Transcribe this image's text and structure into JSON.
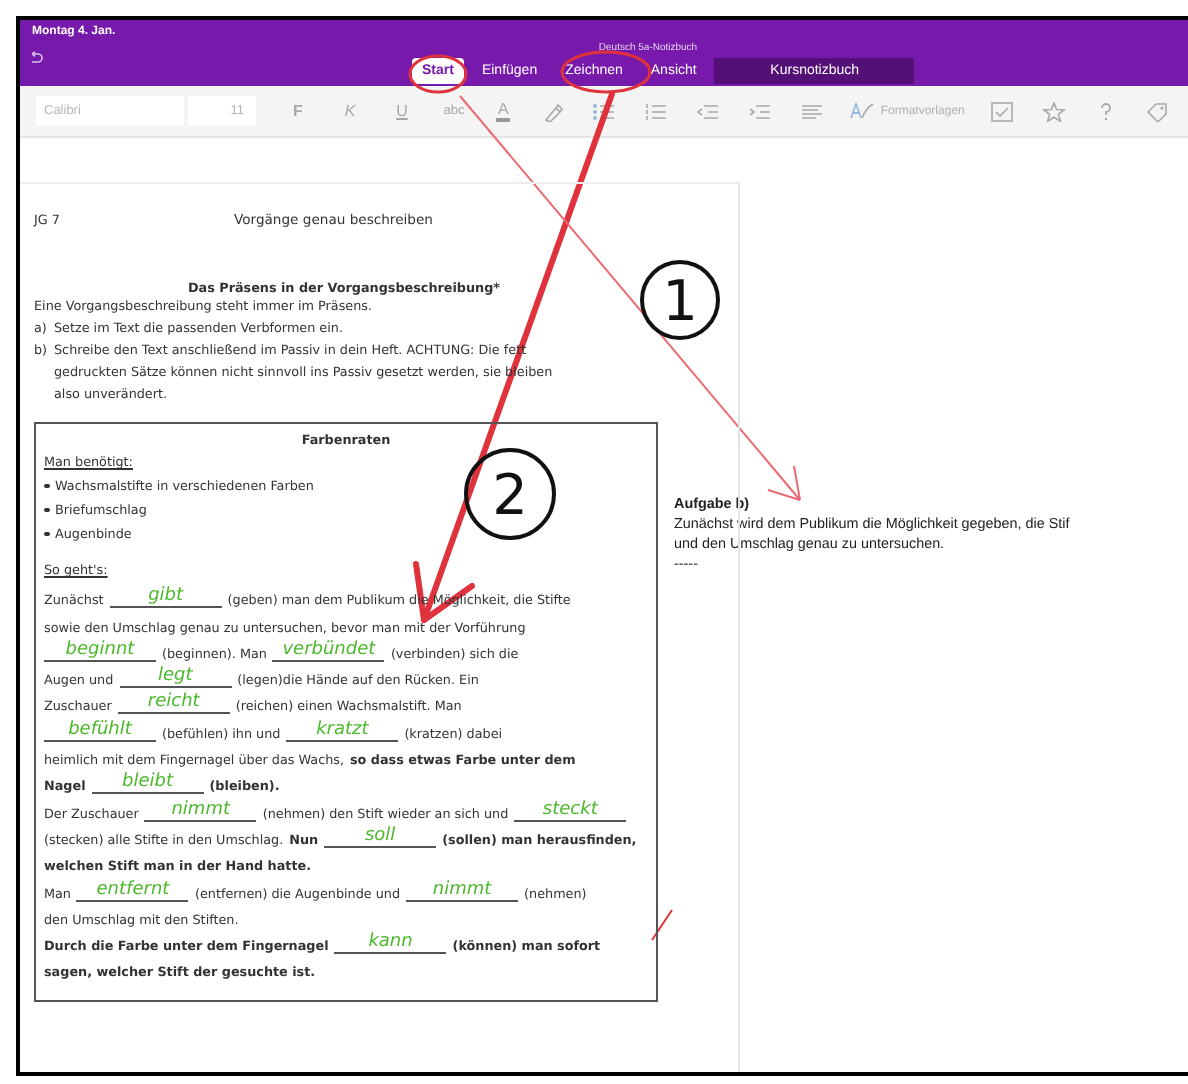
{
  "header": {
    "date": "Montag 4. Jan.",
    "notebook": "Deutsch 5a-Notizbuch"
  },
  "tabs": [
    {
      "label": "Start",
      "selected": true,
      "kind": "ribbon"
    },
    {
      "label": "Einfügen",
      "selected": false,
      "kind": "ribbon"
    },
    {
      "label": "Zeichnen",
      "selected": false,
      "kind": "ribbon"
    },
    {
      "label": "Ansicht",
      "selected": false,
      "kind": "ribbon"
    },
    {
      "label": "Kursnotizbuch",
      "selected": false,
      "kind": "class"
    }
  ],
  "toolbar": {
    "font_name": "Calibri",
    "font_size": "11",
    "format_buttons": [
      "F",
      "K",
      "U",
      "abc"
    ],
    "font_color_button": "A",
    "styles_button": "Formatvorlagen"
  },
  "worksheet": {
    "class": "JG 7",
    "topic": "Vorgänge genau beschreiben",
    "heading": "Das Präsens in der Vorgangsbeschreibung*",
    "intro": "Eine Vorgangsbeschreibung steht immer im Präsens.",
    "tasks": [
      {
        "marker": "a)",
        "lines": [
          "Setze im Text die passenden Verbformen ein."
        ]
      },
      {
        "marker": "b)",
        "lines": [
          "Schreibe den Text anschließend im Passiv in dein Heft. ACHTUNG: Die fett",
          "gedruckten Sätze können nicht sinnvoll ins Passiv gesetzt werden, sie bleiben",
          "also unverändert."
        ]
      }
    ],
    "box": {
      "title": "Farbenraten",
      "materials_label": "Man benötigt:",
      "materials": [
        "Wachsmalstifte in verschiedenen Farben",
        "Briefumschlag",
        "Augenbinde"
      ],
      "steps_label": "So geht's:",
      "lines": [
        [
          {
            "kind": "text",
            "text": "Zunächst",
            "bold": false
          },
          {
            "kind": "blank",
            "answer": "gibt"
          },
          {
            "kind": "text",
            "text": "(geben) man dem Publikum die Möglichkeit, die Stifte",
            "bold": false
          }
        ],
        [
          {
            "kind": "text",
            "text": "sowie den Umschlag genau zu untersuchen, bevor man mit der Vorführung",
            "bold": false
          }
        ],
        [
          {
            "kind": "blank",
            "answer": "beginnt"
          },
          {
            "kind": "text",
            "text": "(beginnen). Man",
            "bold": false
          },
          {
            "kind": "blank",
            "answer": "verbündet"
          },
          {
            "kind": "text",
            "text": "(verbinden) sich die",
            "bold": false
          }
        ],
        [
          {
            "kind": "text",
            "text": "Augen und",
            "bold": false
          },
          {
            "kind": "blank",
            "answer": "legt"
          },
          {
            "kind": "text",
            "text": "(legen)die Hände auf den Rücken. Ein",
            "bold": false
          }
        ],
        [
          {
            "kind": "text",
            "text": "Zuschauer",
            "bold": false
          },
          {
            "kind": "blank",
            "answer": "reicht"
          },
          {
            "kind": "text",
            "text": "(reichen) einen Wachsmalstift. Man",
            "bold": false
          }
        ],
        [
          {
            "kind": "blank",
            "answer": "befühlt"
          },
          {
            "kind": "text",
            "text": "(befühlen) ihn und",
            "bold": false
          },
          {
            "kind": "blank",
            "answer": "kratzt"
          },
          {
            "kind": "text",
            "text": "(kratzen) dabei",
            "bold": false
          }
        ],
        [
          {
            "kind": "text",
            "text": "heimlich mit dem Fingernagel über das Wachs,",
            "bold": false
          },
          {
            "kind": "text",
            "text": "so dass etwas Farbe unter dem",
            "bold": true
          }
        ],
        [
          {
            "kind": "text",
            "text": "Nagel",
            "bold": true
          },
          {
            "kind": "blank",
            "answer": "bleibt"
          },
          {
            "kind": "text",
            "text": "(bleiben).",
            "bold": true
          }
        ],
        [
          {
            "kind": "text",
            "text": "Der Zuschauer",
            "bold": false
          },
          {
            "kind": "blank",
            "answer": "nimmt"
          },
          {
            "kind": "text",
            "text": "(nehmen) den Stift wieder an sich und",
            "bold": false
          },
          {
            "kind": "blank",
            "answer": "steckt"
          }
        ],
        [
          {
            "kind": "text",
            "text": "(stecken) alle Stifte in den Umschlag.",
            "bold": false
          },
          {
            "kind": "text",
            "text": "Nun",
            "bold": true
          },
          {
            "kind": "blank",
            "answer": "soll"
          },
          {
            "kind": "text",
            "text": "(sollen) man herausfinden,",
            "bold": true
          }
        ],
        [
          {
            "kind": "text",
            "text": "welchen Stift man in der Hand hatte.",
            "bold": true
          }
        ],
        [
          {
            "kind": "text",
            "text": "Man",
            "bold": false
          },
          {
            "kind": "blank",
            "answer": "entfernt"
          },
          {
            "kind": "text",
            "text": "(entfernen) die Augenbinde und",
            "bold": false
          },
          {
            "kind": "blank",
            "answer": "nimmt"
          },
          {
            "kind": "text",
            "text": "(nehmen)",
            "bold": false
          }
        ],
        [
          {
            "kind": "text",
            "text": "den Umschlag mit den Stiften.",
            "bold": false
          }
        ],
        [
          {
            "kind": "text",
            "text": "Durch die Farbe unter dem Fingernagel",
            "bold": true
          },
          {
            "kind": "blank",
            "answer": "kann"
          },
          {
            "kind": "text",
            "text": "(können) man sofort",
            "bold": true
          }
        ],
        [
          {
            "kind": "text",
            "text": "sagen, welcher Stift der gesuchte ist.",
            "bold": true
          }
        ]
      ]
    }
  },
  "note": {
    "title": "Aufgabe b)",
    "text": "Zunächst wird dem Publikum die Möglichkeit gegeben, die Stif",
    "line2": "und den Umschlag genau zu untersuchen.",
    "placeholder_line": "-----"
  },
  "annotations": [
    {
      "label": "1"
    },
    {
      "label": "2"
    }
  ]
}
